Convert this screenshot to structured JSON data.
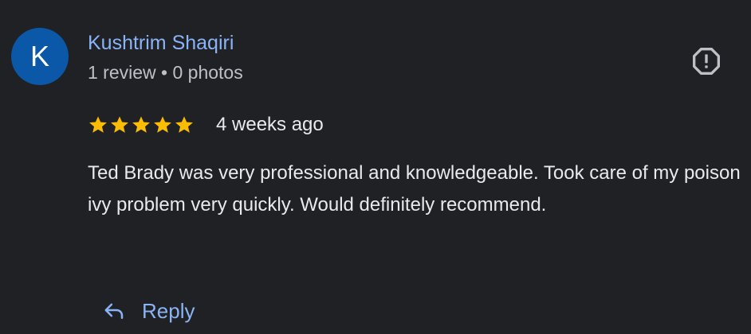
{
  "review": {
    "author": {
      "initial": "K",
      "name": "Kushtrim Shaqiri",
      "meta": "1 review • 0 photos",
      "avatar_color": "#0b57a8",
      "name_color": "#8ab4f8"
    },
    "rating": {
      "stars": 5,
      "max": 5,
      "star_color": "#fbbc04",
      "icon": "star-icon"
    },
    "date": "4 weeks ago",
    "text": "Ted Brady was very professional and knowledgeable. Took care of my poison ivy problem very quickly. Would definitely recommend.",
    "actions": {
      "report_icon": "report-icon",
      "reply_icon": "reply-arrow-icon",
      "reply_label": "Reply"
    },
    "colors": {
      "background": "#202124",
      "text": "#e8eaed",
      "secondary_text": "#bdc1c6",
      "link": "#8ab4f8"
    }
  }
}
